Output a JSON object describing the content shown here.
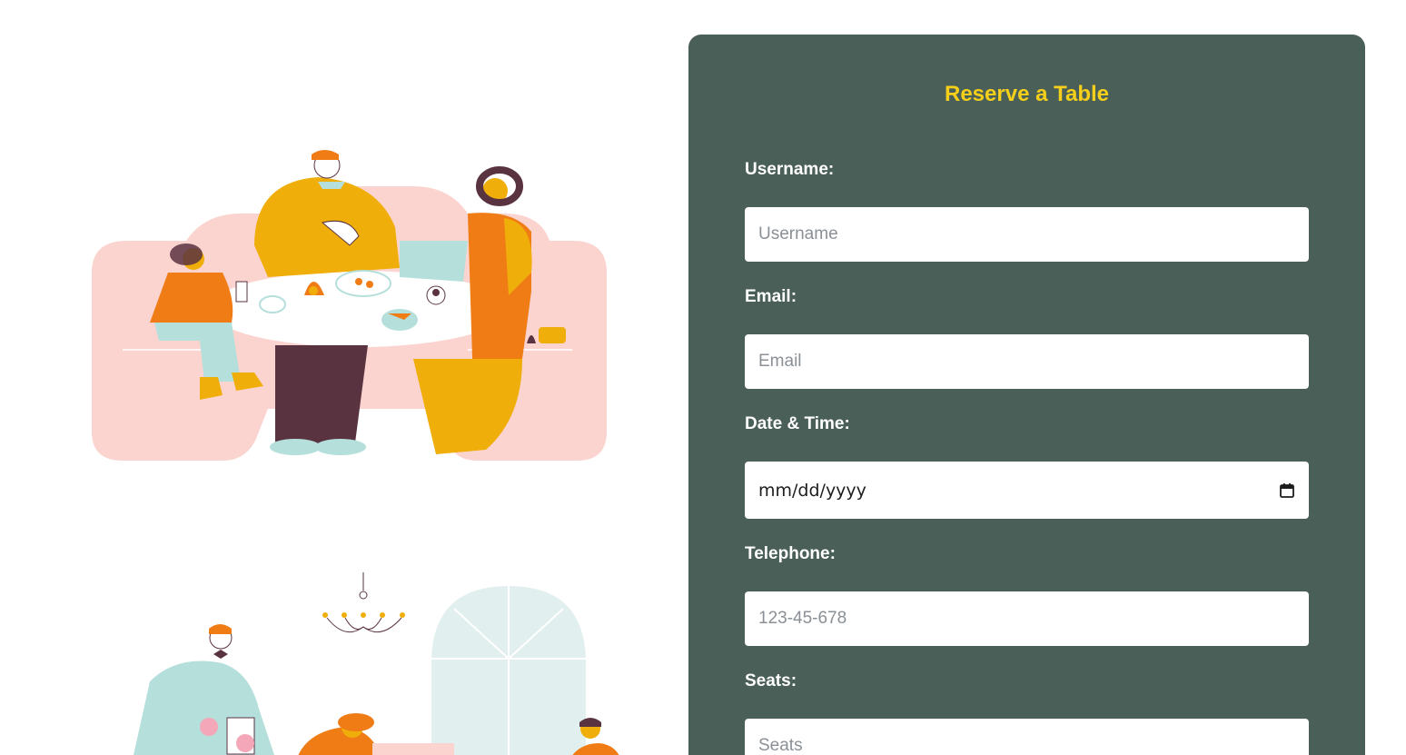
{
  "form": {
    "title": "Reserve a Table",
    "username": {
      "label": "Username:",
      "placeholder": "Username"
    },
    "email": {
      "label": "Email:",
      "placeholder": "Email"
    },
    "datetime": {
      "label": "Date & Time:",
      "placeholder": "mm/dd/yyyy"
    },
    "telephone": {
      "label": "Telephone:",
      "placeholder": "123-45-678"
    },
    "seats": {
      "label": "Seats:",
      "placeholder": "Seats"
    }
  },
  "colors": {
    "panel": "#4a5f57",
    "title": "#f5cf1a",
    "label": "#ffffff"
  },
  "icons": {
    "calendar": "calendar-icon"
  }
}
